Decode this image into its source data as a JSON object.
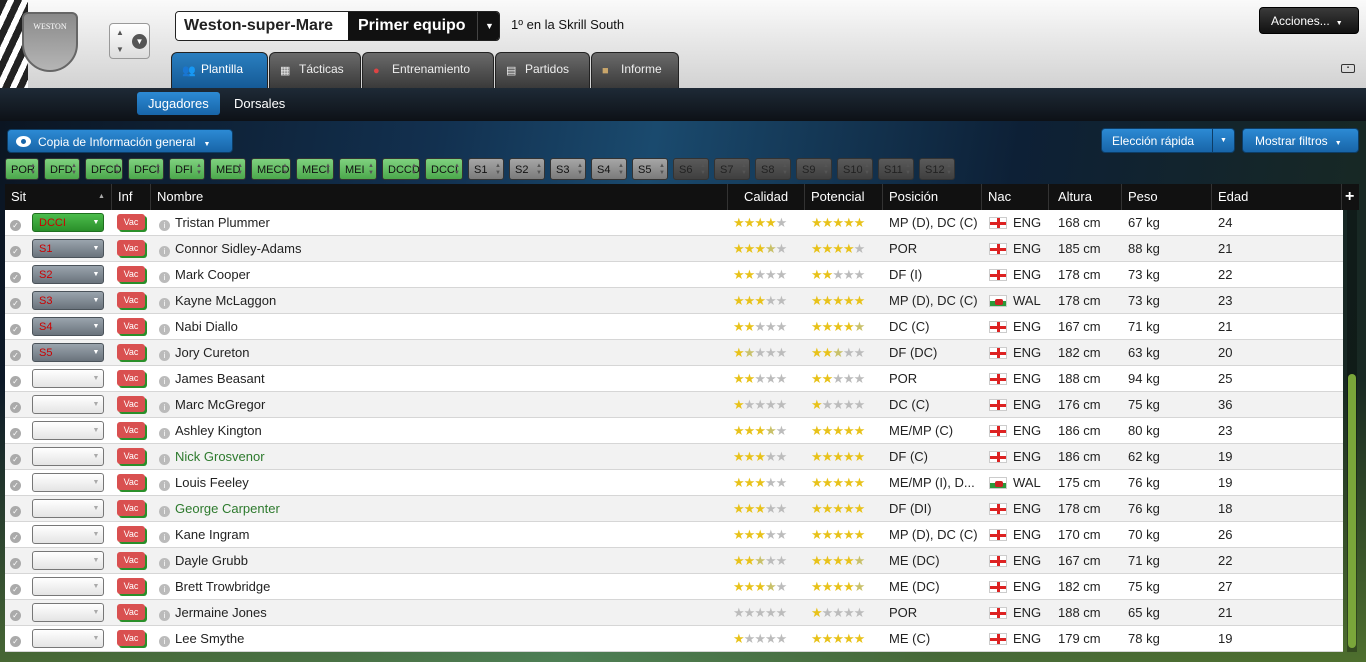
{
  "header": {
    "club_name": "Weston-super-Mare",
    "team": "Primer equipo",
    "league_status": "1º en la Skrill South",
    "crest_text": "WESTON",
    "actions_label": "Acciones..."
  },
  "tabs": [
    {
      "label": "Plantilla",
      "icon": "people-icon"
    },
    {
      "label": "Tácticas",
      "icon": "tactics-icon"
    },
    {
      "label": "Entrenamiento",
      "icon": "whistle-icon"
    },
    {
      "label": "Partidos",
      "icon": "calendar-icon"
    },
    {
      "label": "Informe",
      "icon": "briefcase-icon"
    }
  ],
  "subtabs": [
    "Jugadores",
    "Dorsales"
  ],
  "toolbar": {
    "view_label": "Copia de Información general",
    "quick_pick": "Elección rápida",
    "filters": "Mostrar filtros"
  },
  "position_chips": [
    "POR",
    "DFD",
    "DFCD",
    "DFCI",
    "DFI",
    "MED",
    "MECD",
    "MECI",
    "MEI",
    "DCCD",
    "DCCI",
    "S1",
    "S2",
    "S3",
    "S4",
    "S5",
    "S6",
    "S7",
    "S8",
    "S9",
    "S10",
    "S11",
    "S12"
  ],
  "columns": {
    "sit": "Sit",
    "inf": "Inf",
    "name": "Nombre",
    "quality": "Calidad",
    "potential": "Potencial",
    "position": "Posición",
    "nat": "Nac",
    "height": "Altura",
    "weight": "Peso",
    "age": "Edad",
    "add": "+"
  },
  "players": [
    {
      "sel": "DCCI",
      "vac": "Vac",
      "name": "Tristan Plummer",
      "cal": 4,
      "pot": 5,
      "pos": "MP (D), DC (C)",
      "nac": "ENG",
      "alt": "168 cm",
      "peso": "67 kg",
      "edad": "24"
    },
    {
      "sel": "S1",
      "vac": "Vac",
      "name": "Connor Sidley-Adams",
      "cal": 3.5,
      "pot": 4,
      "pos": "POR",
      "nac": "ENG",
      "alt": "185 cm",
      "peso": "88 kg",
      "edad": "21"
    },
    {
      "sel": "S2",
      "vac": "Vac",
      "name": "Mark Cooper",
      "cal": 2,
      "pot": 2,
      "pos": "DF (I)",
      "nac": "ENG",
      "alt": "178 cm",
      "peso": "73 kg",
      "edad": "22"
    },
    {
      "sel": "S3",
      "vac": "Vac",
      "name": "Kayne McLaggon",
      "cal": 3,
      "pot": 5,
      "pos": "MP (D), DC (C)",
      "nac": "WAL",
      "alt": "178 cm",
      "peso": "73 kg",
      "edad": "23"
    },
    {
      "sel": "S4",
      "vac": "Vac",
      "name": "Nabi Diallo",
      "cal": 2,
      "pot": 4.5,
      "pos": "DC (C)",
      "nac": "ENG",
      "alt": "167 cm",
      "peso": "71 kg",
      "edad": "21"
    },
    {
      "sel": "S5",
      "vac": "Vac",
      "name": "Jory Cureton",
      "cal": 1.5,
      "pot": 2.5,
      "pos": "DF (DC)",
      "nac": "ENG",
      "alt": "182 cm",
      "peso": "63 kg",
      "edad": "20"
    },
    {
      "sel": "",
      "vac": "Vac",
      "name": "James Beasant",
      "cal": 2,
      "pot": 2,
      "pos": "POR",
      "nac": "ENG",
      "alt": "188 cm",
      "peso": "94 kg",
      "edad": "25"
    },
    {
      "sel": "",
      "vac": "Vac",
      "name": "Marc McGregor",
      "cal": 1,
      "pot": 1,
      "pos": "DC (C)",
      "nac": "ENG",
      "alt": "176 cm",
      "peso": "75 kg",
      "edad": "36"
    },
    {
      "sel": "",
      "vac": "Vac",
      "name": "Ashley Kington",
      "cal": 3.5,
      "pot": 5,
      "pos": "ME/MP (C)",
      "nac": "ENG",
      "alt": "186 cm",
      "peso": "80 kg",
      "edad": "23"
    },
    {
      "sel": "",
      "vac": "Vac",
      "name": "Nick Grosvenor",
      "cal": 3,
      "pot": 5,
      "pos": "DF (C)",
      "nac": "ENG",
      "alt": "186 cm",
      "peso": "62 kg",
      "edad": "19",
      "green": true
    },
    {
      "sel": "",
      "vac": "Vac",
      "name": "Louis Feeley",
      "cal": 3,
      "pot": 5,
      "pos": "ME/MP (I), D...",
      "nac": "WAL",
      "alt": "175 cm",
      "peso": "76 kg",
      "edad": "19"
    },
    {
      "sel": "",
      "vac": "Vac",
      "name": "George Carpenter",
      "cal": 3,
      "pot": 5,
      "pos": "DF (DI)",
      "nac": "ENG",
      "alt": "178 cm",
      "peso": "76 kg",
      "edad": "18",
      "green": true
    },
    {
      "sel": "",
      "vac": "Vac",
      "name": "Kane Ingram",
      "cal": 3,
      "pot": 5,
      "pos": "MP (D), DC (C)",
      "nac": "ENG",
      "alt": "170 cm",
      "peso": "70 kg",
      "edad": "26"
    },
    {
      "sel": "",
      "vac": "Vac",
      "name": "Dayle Grubb",
      "cal": 2.5,
      "pot": 4.5,
      "pos": "ME (DC)",
      "nac": "ENG",
      "alt": "167 cm",
      "peso": "71 kg",
      "edad": "22"
    },
    {
      "sel": "",
      "vac": "Vac",
      "name": "Brett Trowbridge",
      "cal": 3.5,
      "pot": 4.5,
      "pos": "ME (DC)",
      "nac": "ENG",
      "alt": "182 cm",
      "peso": "75 kg",
      "edad": "27"
    },
    {
      "sel": "",
      "vac": "Vac",
      "name": "Jermaine Jones",
      "cal": 0,
      "pot": 1,
      "pos": "POR",
      "nac": "ENG",
      "alt": "188 cm",
      "peso": "65 kg",
      "edad": "21"
    },
    {
      "sel": "",
      "vac": "Vac",
      "name": "Lee Smythe",
      "cal": 1,
      "pot": 5,
      "pos": "ME (C)",
      "nac": "ENG",
      "alt": "179 cm",
      "peso": "78 kg",
      "edad": "19"
    }
  ]
}
